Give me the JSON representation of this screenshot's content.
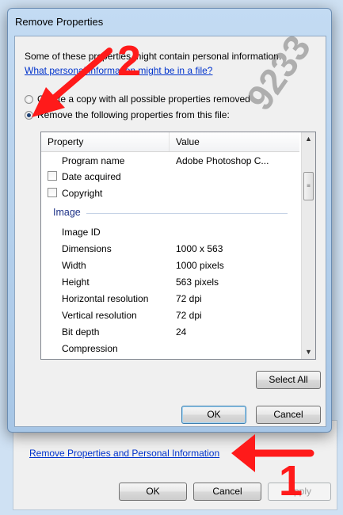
{
  "dialog": {
    "title": "Remove Properties",
    "intro_text": "Some of these properties might contain personal information.",
    "intro_link": "What personal information might be in a file?",
    "options": [
      {
        "label": "Create a copy with all possible properties removed",
        "selected": false
      },
      {
        "label": "Remove the following properties from this file:",
        "selected": true
      }
    ],
    "table": {
      "headers": [
        "Property",
        "Value"
      ],
      "rows_top": [
        {
          "property": "Program name",
          "value": "Adobe Photoshop C...",
          "checkbox": false
        },
        {
          "property": "Date acquired",
          "value": "",
          "checkbox": true
        },
        {
          "property": "Copyright",
          "value": "",
          "checkbox": true
        }
      ],
      "group": "Image",
      "rows_image": [
        {
          "property": "Image ID",
          "value": ""
        },
        {
          "property": "Dimensions",
          "value": "1000 x 563"
        },
        {
          "property": "Width",
          "value": "1000 pixels"
        },
        {
          "property": "Height",
          "value": "563 pixels"
        },
        {
          "property": "Horizontal resolution",
          "value": "72 dpi"
        },
        {
          "property": "Vertical resolution",
          "value": "72 dpi"
        },
        {
          "property": "Bit depth",
          "value": "24"
        },
        {
          "property": "Compression",
          "value": ""
        }
      ]
    },
    "select_all": "Select All",
    "ok": "OK",
    "cancel": "Cancel"
  },
  "parent": {
    "link": "Remove Properties and Personal Information",
    "ok": "OK",
    "cancel": "Cancel",
    "apply": "Apply"
  },
  "annotations": {
    "number_1": "1",
    "number_2": "2",
    "watermark": "9233",
    "color": "#ff1a1a"
  },
  "colors": {
    "link": "#0033cc",
    "group": "#1e3287",
    "titlebar": "#b7d1ec"
  }
}
